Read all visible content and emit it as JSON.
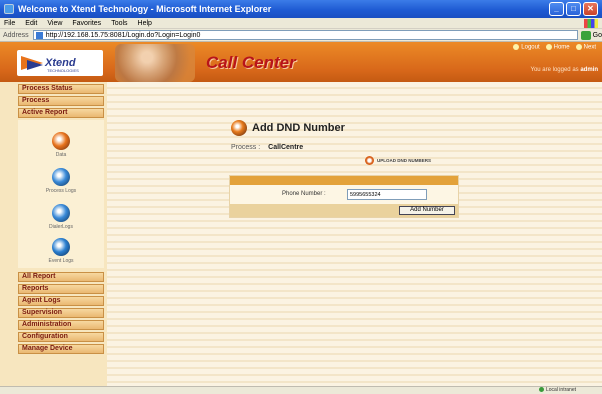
{
  "window": {
    "title": "Welcome to Xtend Technology - Microsoft Internet Explorer",
    "min_label": "_",
    "max_label": "□",
    "close_label": "✕"
  },
  "menubar": [
    "File",
    "Edit",
    "View",
    "Favorites",
    "Tools",
    "Help"
  ],
  "address": {
    "label": "Address",
    "url": "http://192.168.15.75:8081/Login.do?Login=Login0",
    "go_label": "Go"
  },
  "header": {
    "brand": "Xtend",
    "brand_tag": "TECHNOLOGIES",
    "title": "Call Center",
    "links": [
      "Logout",
      "Home",
      "Next"
    ],
    "logged_prefix": "You are logged as",
    "logged_user": "admin"
  },
  "sidebar": {
    "top_items": [
      "Process Status",
      "Process",
      "Active Report"
    ],
    "sub_items": [
      "Data",
      "Process Logs",
      "DialerLogs",
      "Event Logs"
    ],
    "bottom_items": [
      "All Report",
      "Reports",
      "Agent Logs",
      "Supervision",
      "Administration",
      "Configuration",
      "Manage Device"
    ]
  },
  "main": {
    "title": "Add DND Number",
    "process_label": "Process :",
    "process_value": "CallCentre",
    "upload_label": "UPLOAD DND NUMBERS",
    "phone_label": "Phone Number :",
    "phone_value": "5995655324",
    "submit_label": "Add Number"
  },
  "status": {
    "zone": "Local intranet"
  },
  "colors": {
    "header_orange": "#d8681a",
    "title_red": "#b8141a",
    "menu_text": "#7a1a10",
    "form_bar": "#e3a23a"
  }
}
